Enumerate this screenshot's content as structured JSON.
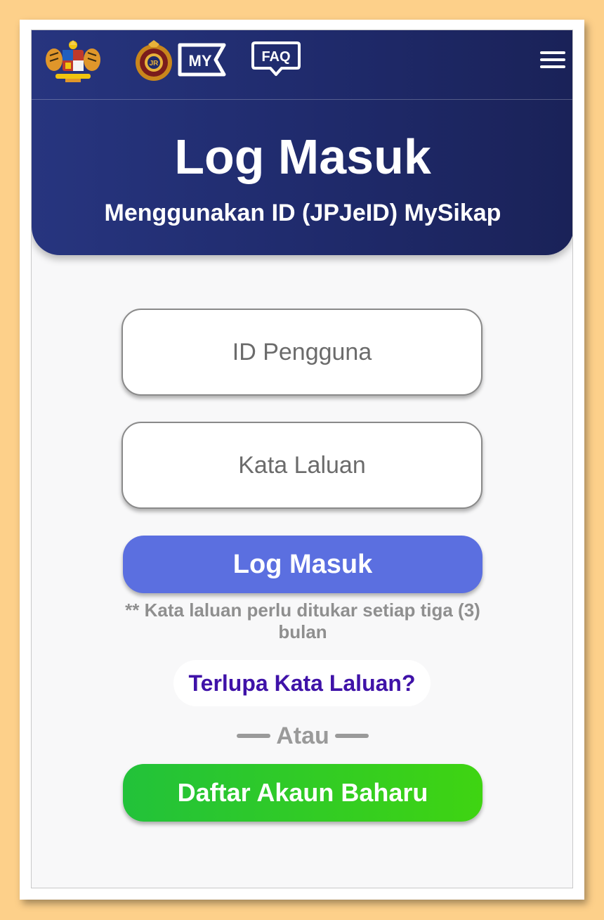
{
  "header": {
    "logos": [
      {
        "name": "malaysia-coat-of-arms",
        "icon": "crest-icon"
      },
      {
        "name": "jpj-logo",
        "icon": "jpj-emblem-icon"
      },
      {
        "name": "my-icon",
        "label": "MY"
      },
      {
        "name": "faq-icon",
        "label": "FAQ"
      }
    ],
    "menu_icon": "hamburger-menu-icon",
    "title": "Log Masuk",
    "subtitle": "Menggunakan ID (JPJeID) MySikap"
  },
  "form": {
    "username_placeholder": "ID Pengguna",
    "password_placeholder": "Kata Laluan",
    "login_button": "Log Masuk",
    "note": "** Kata laluan perlu ditukar setiap tiga (3) bulan",
    "forgot_link": "Terlupa Kata Laluan?",
    "divider_text": "Atau",
    "register_button": "Daftar Akaun Baharu"
  },
  "colors": {
    "header_bg": "#1f2a6b",
    "login_button": "#5b6fe0",
    "register_button": "#2ec81f",
    "forgot_link": "#3f12a8",
    "page_border": "#fdd08a"
  }
}
